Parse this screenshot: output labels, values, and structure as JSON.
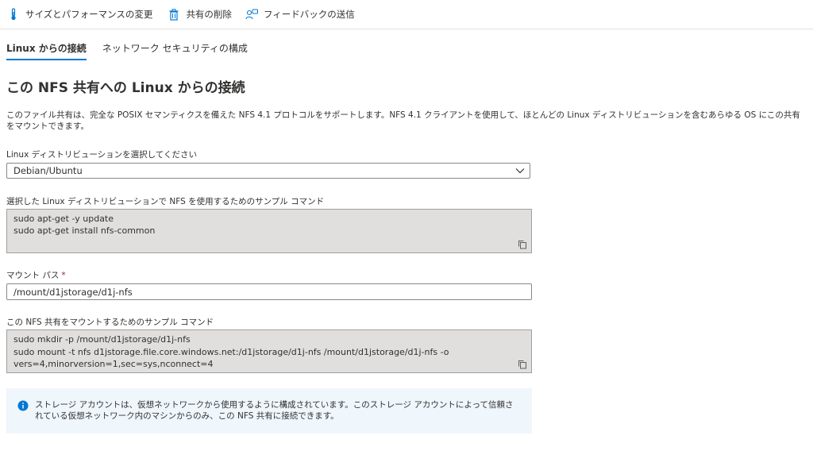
{
  "toolbar": {
    "size_performance": "サイズとパフォーマンスの変更",
    "delete_share": "共有の削除",
    "feedback": "フィードバックの送信"
  },
  "tabs": [
    {
      "label": "Linux からの接続",
      "active": true
    },
    {
      "label": "ネットワーク セキュリティの構成",
      "active": false
    }
  ],
  "heading": "この NFS 共有への Linux からの接続",
  "description": "このファイル共有は、完全な POSIX セマンティクスを備えた NFS 4.1 プロトコルをサポートします。NFS 4.1 クライアントを使用して、ほとんどの Linux ディストリビューションを含むあらゆる OS にこの共有をマウントできます。",
  "distro": {
    "label": "Linux ディストリビューションを選択してください",
    "selected": "Debian/Ubuntu"
  },
  "sample_commands": {
    "label": "選択した Linux ディストリビューションで NFS を使用するためのサンプル コマンド",
    "lines": [
      "sudo apt-get -y update",
      "sudo apt-get install nfs-common"
    ]
  },
  "mount_path": {
    "label": "マウント パス",
    "required_mark": "*",
    "value": "/mount/d1jstorage/d1j-nfs"
  },
  "mount_commands": {
    "label": "この NFS 共有をマウントするためのサンプル コマンド",
    "lines": [
      "sudo mkdir -p /mount/d1jstorage/d1j-nfs",
      "sudo mount -t nfs d1jstorage.file.core.windows.net:/d1jstorage/d1j-nfs /mount/d1jstorage/d1j-nfs -o",
      "vers=4,minorversion=1,sec=sys,nconnect=4"
    ]
  },
  "info_message": "ストレージ アカウントは、仮想ネットワークから使用するように構成されています。このストレージ アカウントによって信頼されている仮想ネットワーク内のマシンからのみ、この NFS 共有に接続できます。",
  "colors": {
    "accent": "#0078d4",
    "required": "#a4262c",
    "code_bg": "#e1dfdd",
    "info_bg": "#eff6fc"
  }
}
